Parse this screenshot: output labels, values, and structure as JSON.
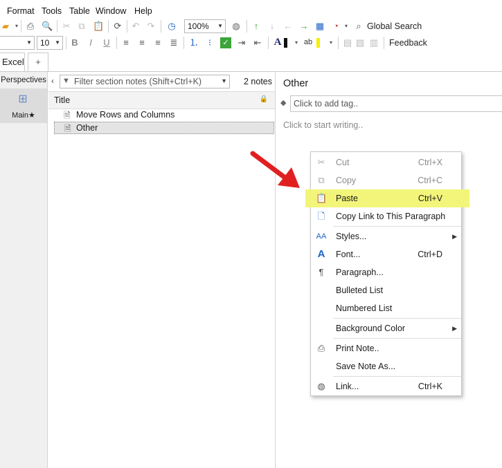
{
  "menubar": {
    "items": [
      "Format",
      "Tools",
      "Table",
      "Window",
      "Help"
    ]
  },
  "toolbar": {
    "zoom": "100%",
    "global_search": "Global Search",
    "font_size": "10",
    "bold": "B",
    "italic": "I",
    "underline": "U",
    "font_color_glyph": "A",
    "highlight_glyph": "ab",
    "feedback": "Feedback"
  },
  "tabs": {
    "active": "Excel",
    "add": "+"
  },
  "perspectives": {
    "title": "Perspectives",
    "main_label": "Main★"
  },
  "notes": {
    "filter_placeholder": "Filter section notes (Shift+Ctrl+K)",
    "count": "2 notes",
    "column_title": "Title",
    "items": [
      "Move Rows and Columns",
      "Other"
    ]
  },
  "pane": {
    "title": "Other",
    "tag_placeholder": "Click to add tag..",
    "body_placeholder": "Click to start writing.."
  },
  "context_menu": {
    "cut": "Cut",
    "cut_sc": "Ctrl+X",
    "copy": "Copy",
    "copy_sc": "Ctrl+C",
    "paste": "Paste",
    "paste_sc": "Ctrl+V",
    "copy_link": "Copy Link to This Paragraph",
    "styles": "Styles...",
    "font": "Font...",
    "font_sc": "Ctrl+D",
    "paragraph": "Paragraph...",
    "bulleted": "Bulleted List",
    "numbered": "Numbered List",
    "background": "Background Color",
    "print": "Print Note..",
    "save": "Save Note As...",
    "link": "Link...",
    "link_sc": "Ctrl+K"
  },
  "colors": {
    "highlight": "#f2f57a",
    "arrow": "#e02020",
    "accent_green": "#3aa53a",
    "accent_blue": "#1e63c7"
  }
}
